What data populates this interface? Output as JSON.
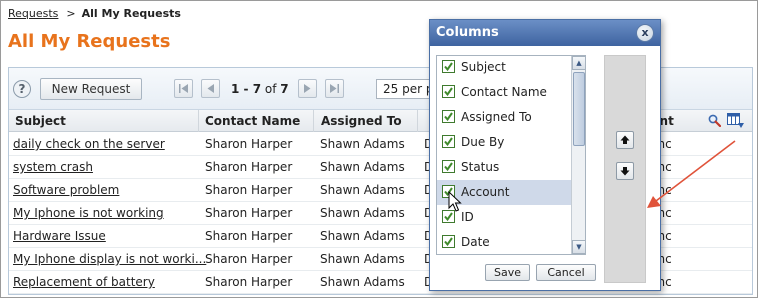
{
  "breadcrumb": {
    "link": "Requests",
    "separator": ">",
    "current": "All My Requests"
  },
  "page_title": "All My Requests",
  "toolbar": {
    "help_label": "?",
    "new_request_label": "New Request",
    "paging": {
      "start": "1",
      "dash": " - ",
      "end": "7",
      "of": " of ",
      "total": "7"
    },
    "per_page_value": "25 per p"
  },
  "grid": {
    "columns": [
      "Subject",
      "Contact Name",
      "Assigned To",
      "",
      "unt"
    ],
    "rows": [
      {
        "subject": "daily check on the server",
        "contact": "Sharon Harper",
        "assigned": "Shawn Adams",
        "col4": "D",
        "account": "Inc"
      },
      {
        "subject": "system crash",
        "contact": "Sharon Harper",
        "assigned": "Shawn Adams",
        "col4": "D",
        "account": "Inc"
      },
      {
        "subject": "Software problem",
        "contact": "Sharon Harper",
        "assigned": "Shawn Adams",
        "col4": "D",
        "account": "Inc"
      },
      {
        "subject": "My Iphone is not working",
        "contact": "Sharon Harper",
        "assigned": "Shawn Adams",
        "col4": "D",
        "account": "Inc"
      },
      {
        "subject": "Hardware Issue",
        "contact": "Sharon Harper",
        "assigned": "Shawn Adams",
        "col4": "D",
        "account": "Inc"
      },
      {
        "subject": "My Iphone display is not worki...",
        "contact": "Sharon Harper",
        "assigned": "Shawn Adams",
        "col4": "D",
        "account": "Inc"
      },
      {
        "subject": "Replacement of battery",
        "contact": "Sharon Harper",
        "assigned": "Shawn Adams",
        "col4": "D",
        "account": "Inc"
      }
    ]
  },
  "columns_dialog": {
    "title": "Columns",
    "close_label": "x",
    "items": [
      {
        "label": "Subject",
        "checked": true,
        "selected": false
      },
      {
        "label": "Contact Name",
        "checked": true,
        "selected": false
      },
      {
        "label": "Assigned To",
        "checked": true,
        "selected": false
      },
      {
        "label": "Due By",
        "checked": true,
        "selected": false
      },
      {
        "label": "Status",
        "checked": true,
        "selected": false
      },
      {
        "label": "Account",
        "checked": true,
        "selected": true
      },
      {
        "label": "ID",
        "checked": true,
        "selected": false
      },
      {
        "label": "Date",
        "checked": true,
        "selected": false
      }
    ],
    "save_label": "Save",
    "cancel_label": "Cancel"
  },
  "colors": {
    "title_orange": "#e8731c",
    "dialog_blue": "#3e63a0",
    "arrow_red": "#e0533a",
    "check_green": "#3f8a2a"
  },
  "icons": [
    "help-icon",
    "first-page-icon",
    "prev-page-icon",
    "next-page-icon",
    "last-page-icon",
    "search-icon",
    "columns-chooser-icon",
    "close-icon",
    "move-up-icon",
    "move-down-icon",
    "mouse-cursor-icon"
  ]
}
